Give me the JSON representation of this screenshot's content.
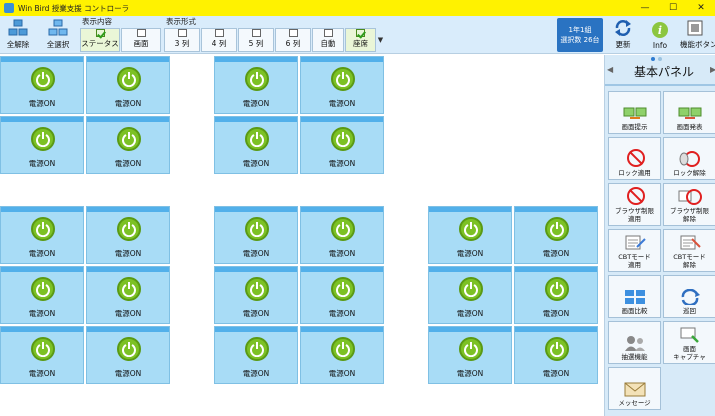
{
  "window": {
    "title": "Win Bird 授業支援 コントローラ",
    "controls": [
      "—",
      "☐",
      "✕"
    ]
  },
  "toolbar": {
    "deselect_all": "全解除",
    "select_all": "全選択",
    "display_content_label": "表示内容",
    "status": "ステータス",
    "screen": "画面",
    "display_format_label": "表示形式",
    "col3": "3 列",
    "col4": "4 列",
    "col5": "5 列",
    "col6": "6 列",
    "auto": "自動",
    "seat": "座席",
    "class_info": "1年1組",
    "selected_count": "選択数 26台",
    "refresh": "更新",
    "info": "Info",
    "function_button": "機能ボタン"
  },
  "status_text": "電源ON",
  "side_panel": {
    "title": "基本パネル",
    "buttons": {
      "screen_present": "画面提示",
      "screen_presentation": "画面発表",
      "lock_apply": "ロック適用",
      "lock_release": "ロック解除",
      "browser_restrict_apply": "ブラウザ制限\n適用",
      "browser_restrict_release": "ブラウザ制限\n解除",
      "cbt_apply": "CBTモード\n適用",
      "cbt_release": "CBTモード\n解除",
      "screen_compare": "画面比較",
      "patrol": "巡回",
      "lottery": "抽選機能",
      "screen_capture": "画面\nキャプチャ",
      "message": "メッセージ"
    }
  },
  "colors": {
    "title_bar": "#fff200",
    "toolbar_bg": "#d9ecfb",
    "seat_bg": "#a8dcf6",
    "seat_header": "#52b0ea",
    "power_green": "#7cc125",
    "badge_blue": "#2a73c2"
  }
}
